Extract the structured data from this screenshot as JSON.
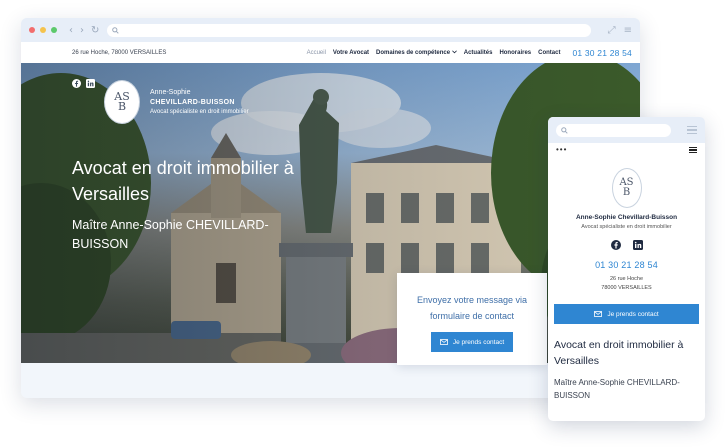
{
  "desktop": {
    "topbar": {
      "address": "26 rue Hoche, 78000 VERSAILLES",
      "nav": [
        "Accueil",
        "Votre Avocat",
        "Domaines de compétence",
        "Actualités",
        "Honoraires",
        "Contact"
      ],
      "nav_dropdown_icon": "chevron-down-icon",
      "phone": "01 30 21 28 54"
    },
    "brand": {
      "logo_letters": "ASB",
      "first_name": "Anne-Sophie",
      "last_name": "CHEVILLARD-BUISSON",
      "tagline": "Avocat spécialiste en droit immobilier"
    },
    "hero": {
      "title": "Avocat en droit immobilier à Versailles",
      "subtitle": "Maître Anne-Sophie CHEVILLARD-BUISSON"
    },
    "contact_card": {
      "line1": "Envoyez votre message via",
      "line2": "formulaire de contact",
      "button": "Je prends contact"
    }
  },
  "mobile": {
    "name": "Anne-Sophie Chevillard-Buisson",
    "tagline": "Avocat spécialiste en droit immobilier",
    "phone": "01 30 21 28 54",
    "address_line1": "26 rue Hoche",
    "address_line2": "78000 VERSAILLES",
    "button": "Je prends contact",
    "title": "Avocat en droit immobilier à Versailles",
    "subtitle": "Maître Anne-Sophie CHEVILLARD-BUISSON"
  },
  "colors": {
    "accent": "#2f86d2",
    "dot_red": "#f26d6d",
    "dot_yellow": "#f5c34d",
    "dot_green": "#5cc96b"
  }
}
